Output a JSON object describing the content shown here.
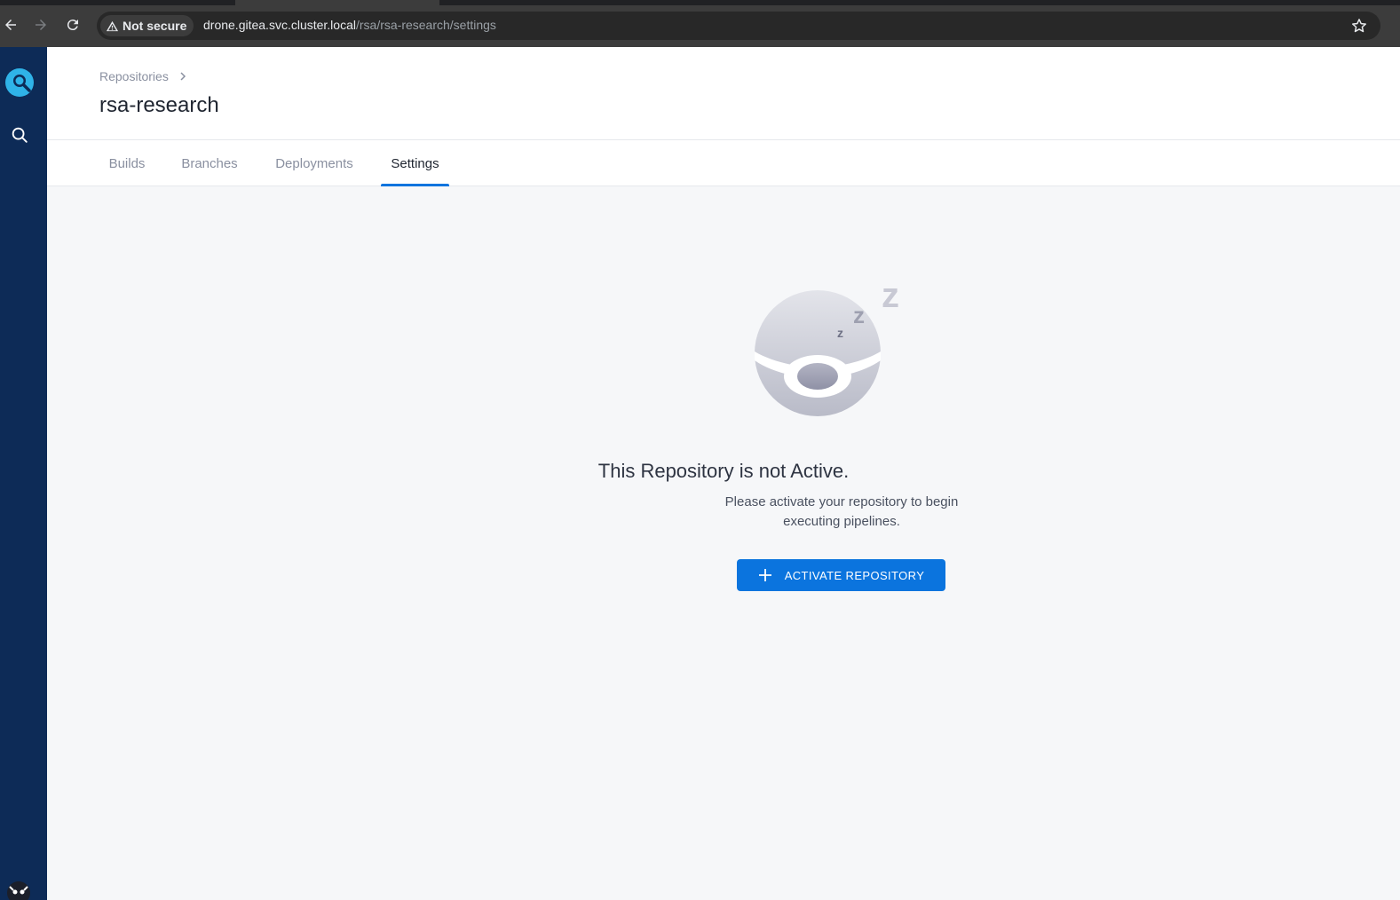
{
  "browser": {
    "security_label": "Not secure",
    "url_host": "drone.gitea.svc.cluster.local",
    "url_path": "/rsa/rsa-research/settings"
  },
  "sidebar": {
    "logo_icon": "drone-logo-icon",
    "search_icon": "search-icon",
    "avatar_icon": "user-avatar-icon"
  },
  "header": {
    "breadcrumb_root": "Repositories",
    "title": "rsa-research"
  },
  "tabs": [
    {
      "label": "Builds"
    },
    {
      "label": "Branches"
    },
    {
      "label": "Deployments"
    },
    {
      "label": "Settings",
      "active": true
    }
  ],
  "empty_state": {
    "title": "This Repository is not Active.",
    "description": "Please activate your repository to begin executing pipelines.",
    "button_label": "ACTIVATE REPOSITORY"
  },
  "colors": {
    "accent": "#0b74de",
    "sidebar": "#0d2b57"
  }
}
